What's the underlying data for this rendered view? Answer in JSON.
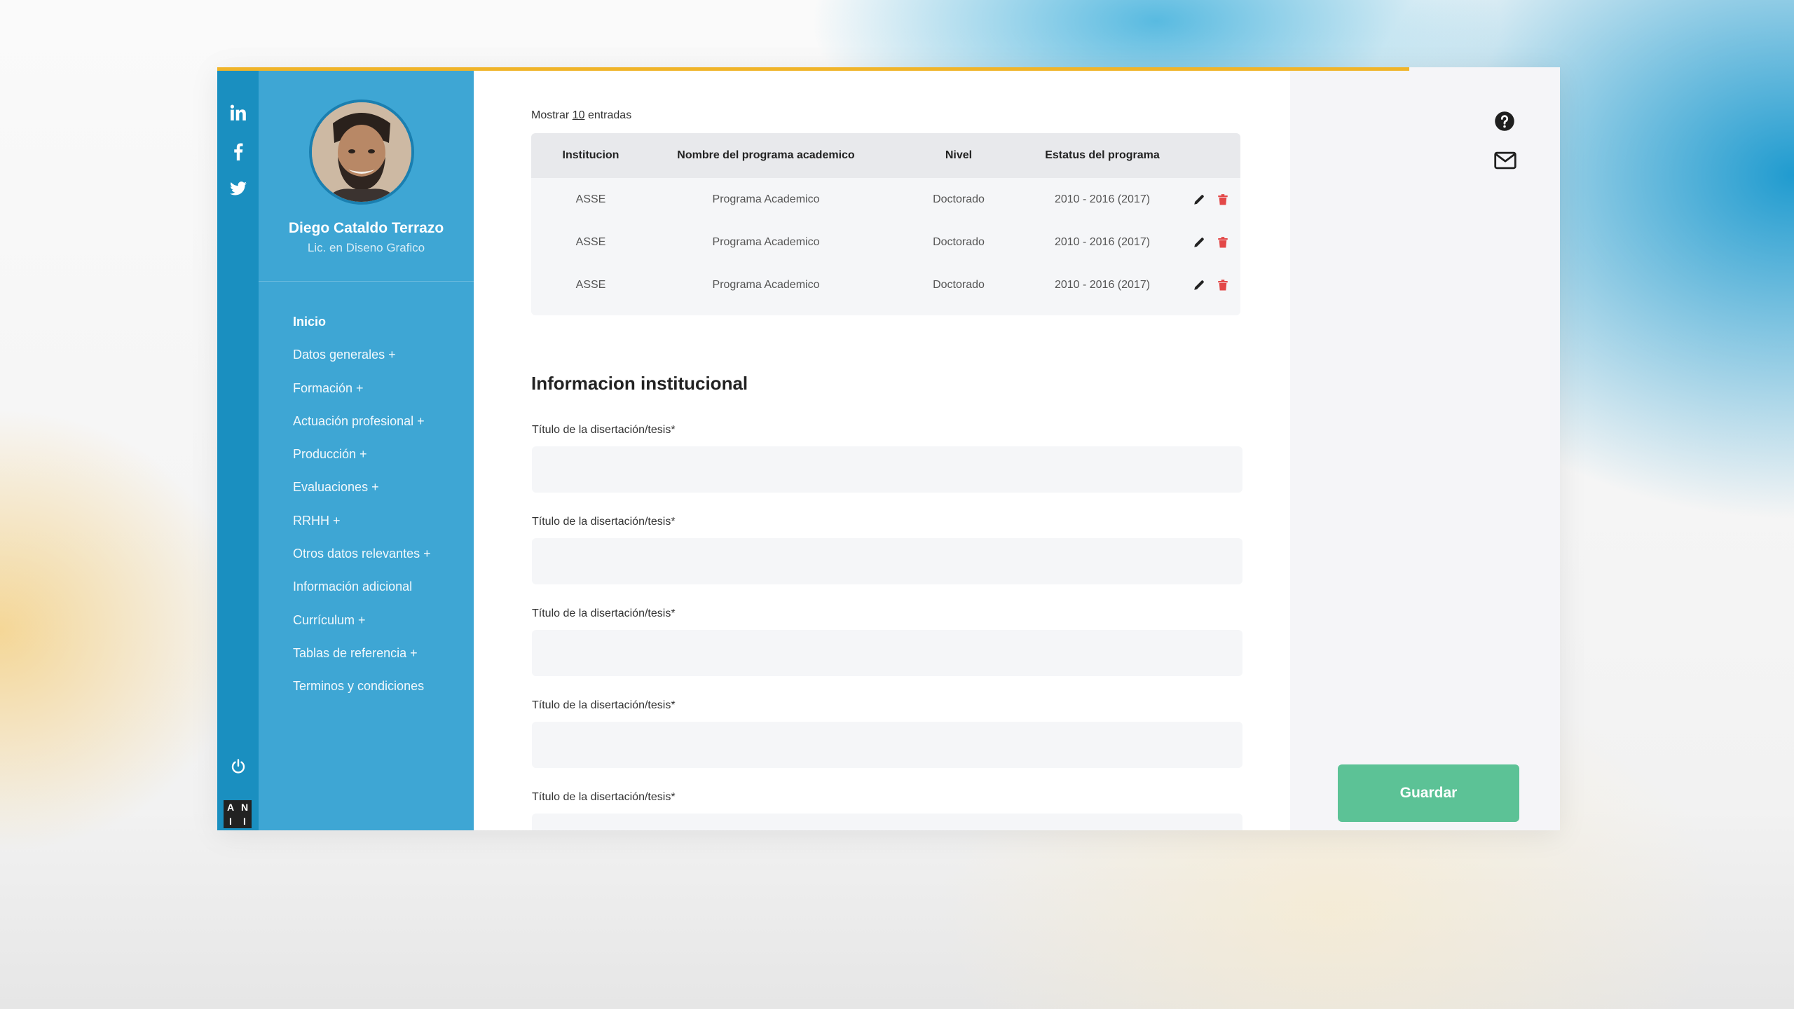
{
  "colors": {
    "rail": "#1a8fc0",
    "sidebar": "#3ea6d4",
    "accent_line": "#f0b429",
    "save_button": "#5cc296",
    "delete_icon": "#e34848"
  },
  "social": {
    "icons": [
      "linkedin-icon",
      "facebook-icon",
      "twitter-icon"
    ],
    "bottom_icons": [
      "power-icon",
      "anii-logo"
    ],
    "logo_letters": [
      "A",
      "N",
      "I",
      "I"
    ]
  },
  "profile": {
    "name": "Diego Cataldo Terrazo",
    "role": "Lic. en Diseno Grafico"
  },
  "nav": {
    "items": [
      {
        "label": "Inicio"
      },
      {
        "label": "Datos generales +"
      },
      {
        "label": "Formación +"
      },
      {
        "label": "Actuación profesional +"
      },
      {
        "label": "Producción +"
      },
      {
        "label": "Evaluaciones +"
      },
      {
        "label": "RRHH +"
      },
      {
        "label": "Otros datos relevantes +"
      },
      {
        "label": "Información adicional"
      },
      {
        "label": "Currículum +"
      },
      {
        "label": "Tablas de referencia +"
      },
      {
        "label": "Terminos y condiciones"
      }
    ]
  },
  "table": {
    "show_prefix": "Mostrar",
    "show_count": "10",
    "show_suffix": "entradas",
    "headers": [
      "Institucion",
      "Nombre del programa academico",
      "Nivel",
      "Estatus del programa"
    ],
    "rows": [
      [
        "ASSE",
        "Programa Academico",
        "Doctorado",
        "2010 - 2016 (2017)"
      ],
      [
        "ASSE",
        "Programa Academico",
        "Doctorado",
        "2010 - 2016 (2017)"
      ],
      [
        "ASSE",
        "Programa Academico",
        "Doctorado",
        "2010 - 2016 (2017)"
      ]
    ]
  },
  "form": {
    "section_title": "Informacion institucional",
    "fields": [
      {
        "label": "Título de la disertación/tesis*",
        "value": ""
      },
      {
        "label": "Título de la disertación/tesis*",
        "value": ""
      },
      {
        "label": "Título de la disertación/tesis*",
        "value": ""
      },
      {
        "label": "Título de la disertación/tesis*",
        "value": ""
      },
      {
        "label": "Título de la disertación/tesis*",
        "value": ""
      }
    ]
  },
  "actions": {
    "right_icons": [
      "help-icon",
      "mail-icon"
    ],
    "save_label": "Guardar"
  }
}
